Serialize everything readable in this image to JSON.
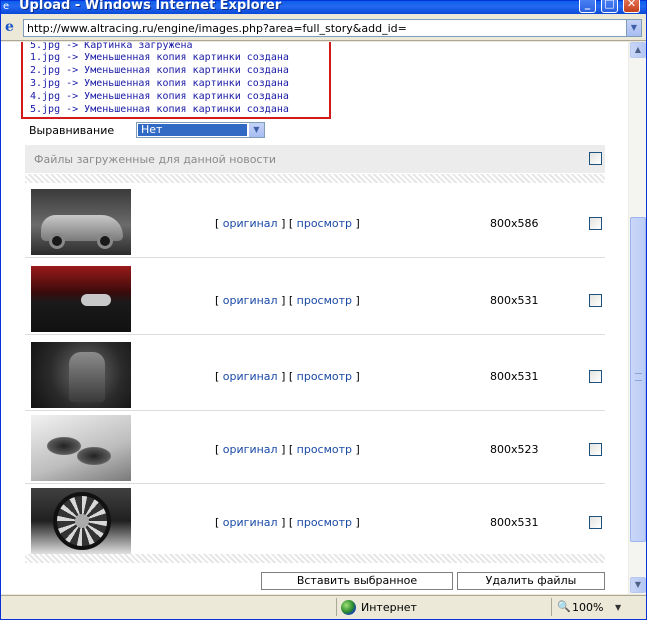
{
  "window": {
    "title": "Upload - Windows Internet Explorer",
    "minimize_glyph": "_",
    "maximize_glyph": "□",
    "close_glyph": "✕"
  },
  "address": {
    "url": "http://www.altracing.ru/engine/images.php?area=full_story&add_id="
  },
  "log": {
    "lines": [
      "5.jpg -> Картинка загружена",
      "1.jpg -> Уменьшенная копия картинки создана",
      "2.jpg -> Уменьшенная копия картинки создана",
      "3.jpg -> Уменьшенная копия картинки создана",
      "4.jpg -> Уменьшенная копия картинки создана",
      "5.jpg -> Уменьшенная копия картинки создана"
    ]
  },
  "align": {
    "label": "Выравнивание",
    "selected": "Нет"
  },
  "files": {
    "header": "Файлы загруженные для данной новости",
    "open_bracket": "[",
    "close_bracket": "]",
    "original_label": "оригинал",
    "preview_label": "просмотр",
    "rows": [
      {
        "thumb_icon": "car-photo",
        "dims": "800x586"
      },
      {
        "thumb_icon": "car-badge-photo",
        "dims": "800x531"
      },
      {
        "thumb_icon": "car-seat-photo",
        "dims": "800x531"
      },
      {
        "thumb_icon": "exhaust-pipes-photo",
        "dims": "800x523"
      },
      {
        "thumb_icon": "wheel-rim-photo",
        "dims": "800x531"
      }
    ]
  },
  "buttons": {
    "insert": "Вставить выбранное",
    "delete": "Удалить файлы"
  },
  "status": {
    "zone": "Интернет",
    "zoom": "100%",
    "zoom_glyph": "🔍"
  }
}
